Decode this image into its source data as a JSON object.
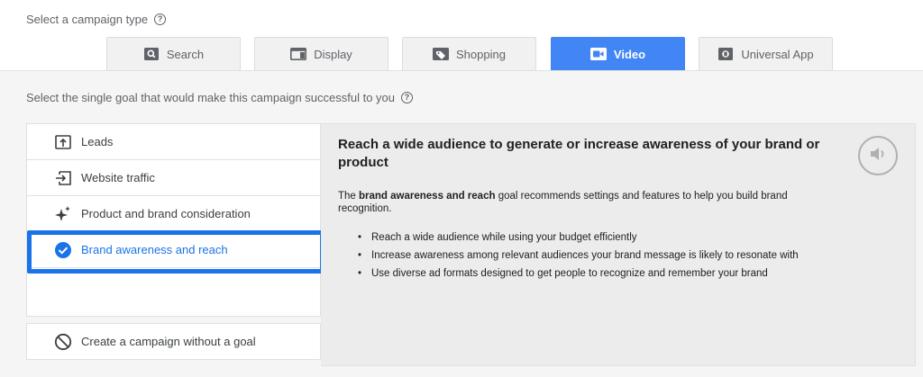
{
  "header": {
    "select_type_label": "Select a campaign type"
  },
  "campaign_types": [
    {
      "label": "Search",
      "icon": "search-icon",
      "active": false
    },
    {
      "label": "Display",
      "icon": "display-icon",
      "active": false
    },
    {
      "label": "Shopping",
      "icon": "shopping-tag-icon",
      "active": false
    },
    {
      "label": "Video",
      "icon": "video-icon",
      "active": true
    },
    {
      "label": "Universal App",
      "icon": "universal-app-icon",
      "active": false
    }
  ],
  "goal_prompt": "Select the single goal that would make this campaign successful to you",
  "goals": [
    {
      "label": "Leads",
      "icon": "leads-icon",
      "selected": false
    },
    {
      "label": "Website traffic",
      "icon": "website-traffic-icon",
      "selected": false
    },
    {
      "label": "Product and brand consideration",
      "icon": "sparkle-icon",
      "selected": false
    },
    {
      "label": "Brand awareness and reach",
      "icon": "check-circle-icon",
      "selected": true
    }
  ],
  "no_goal": {
    "label": "Create a campaign without a goal",
    "icon": "no-goal-icon"
  },
  "detail": {
    "title": "Reach a wide audience to generate or increase awareness of your brand or product",
    "desc_prefix": "The ",
    "desc_bold": "brand awareness and reach",
    "desc_suffix": " goal recommends settings and features to help you build brand recognition.",
    "bullets": [
      "Reach a wide audience while using your budget efficiently",
      "Increase awareness among relevant audiences your brand message is likely to resonate with",
      "Use diverse ad formats designed to get people to recognize and remember your brand"
    ],
    "icon": "speaker-icon"
  },
  "colors": {
    "accent": "#4285f4",
    "selected_text": "#1a73e8",
    "panel_bg": "#ececec"
  }
}
